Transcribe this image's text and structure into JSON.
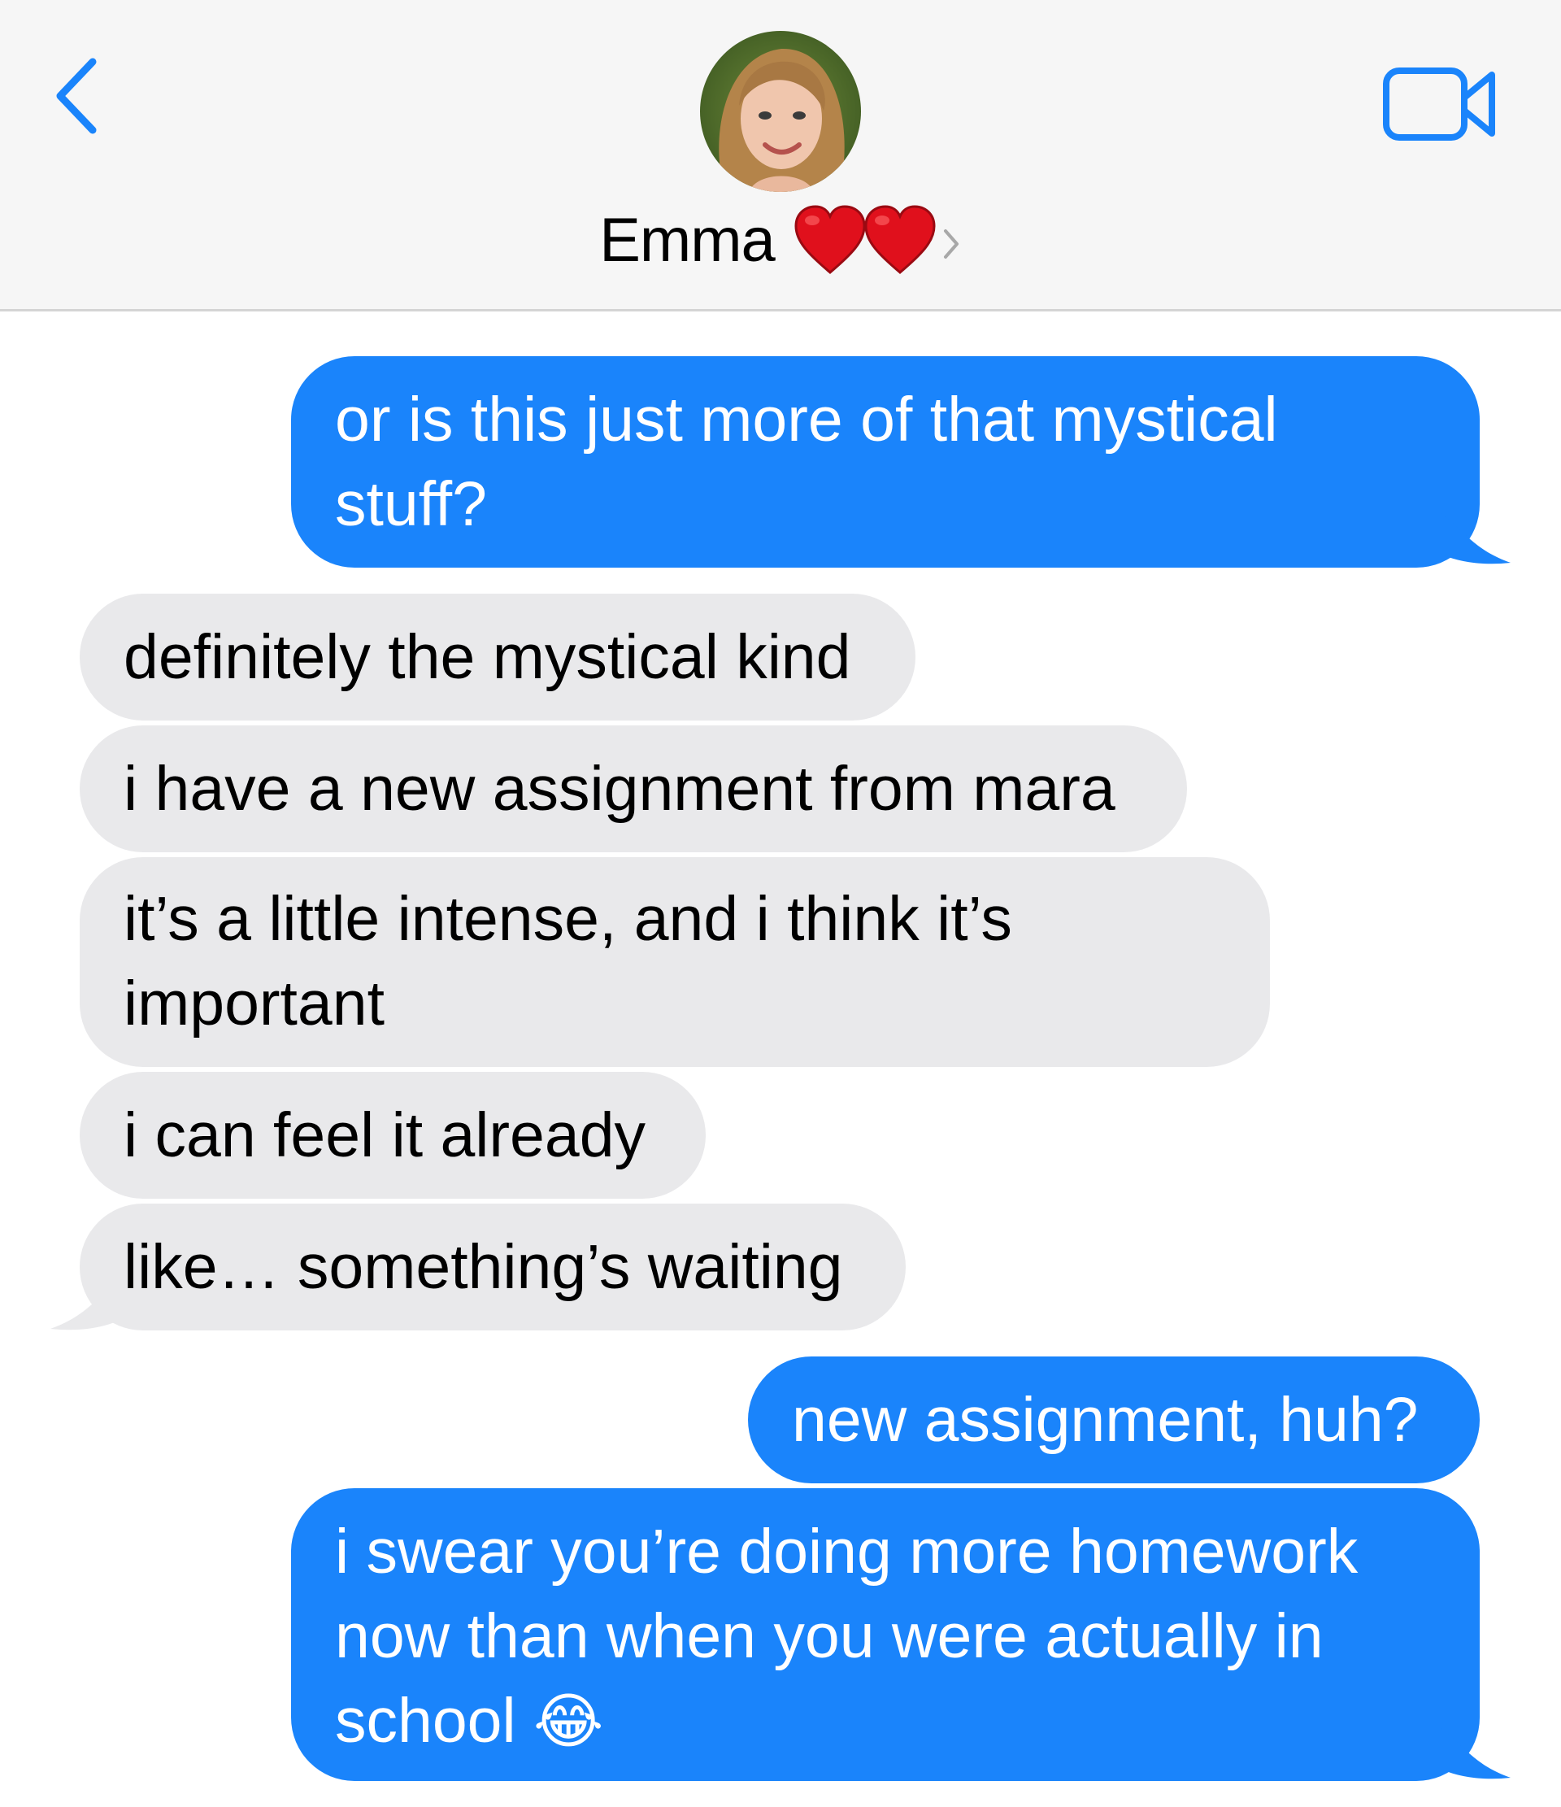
{
  "header": {
    "contact_name": "Emma",
    "back_icon": "chevron-left-icon",
    "video_icon": "video-camera-icon",
    "name_suffix_icons": [
      "red-heart-icon",
      "red-heart-icon",
      "chevron-right-icon"
    ],
    "accent_color": "#1a84fb"
  },
  "messages": [
    {
      "direction": "sent",
      "text": "or is this just more of that mystical stuff?"
    },
    {
      "direction": "received",
      "text": "definitely the mystical kind"
    },
    {
      "direction": "received",
      "text": "i have a new assignment from mara"
    },
    {
      "direction": "received",
      "text": "it’s a little intense, and i think it’s important"
    },
    {
      "direction": "received",
      "text": "i can feel it already"
    },
    {
      "direction": "received",
      "text": "like… something’s waiting"
    },
    {
      "direction": "sent",
      "text": "new assignment, huh?"
    },
    {
      "direction": "sent",
      "text": "i swear you’re doing more homework now than when you were actually in school",
      "emoji": "😂"
    }
  ],
  "colors": {
    "sent_bubble": "#1a84fb",
    "received_bubble": "#e9e9eb",
    "header_bg": "#f6f6f6"
  }
}
